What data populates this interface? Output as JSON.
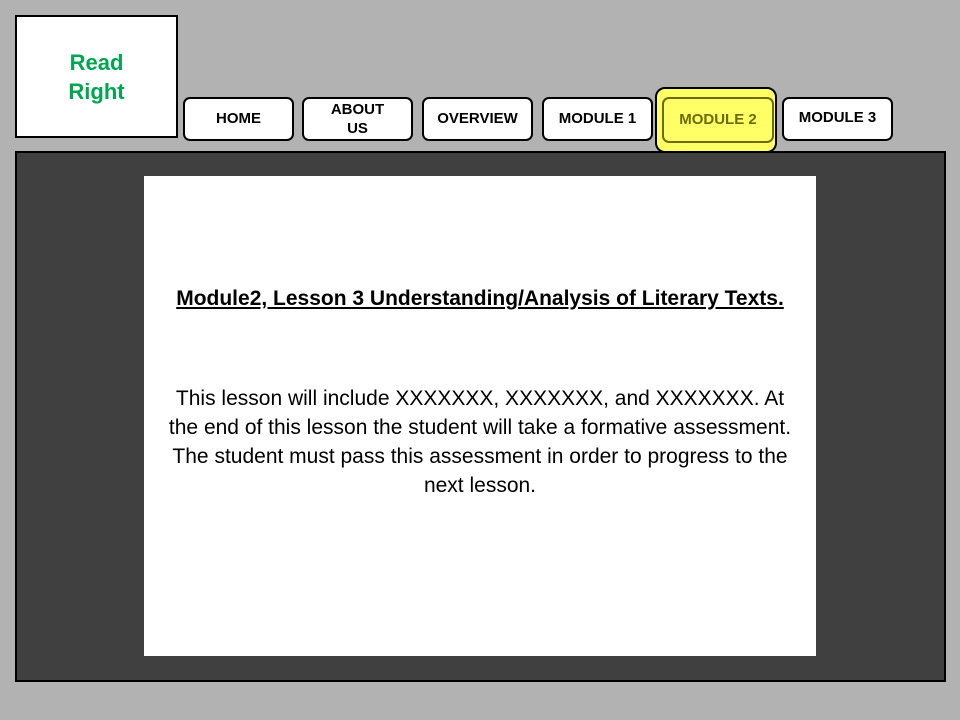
{
  "logo": {
    "line1": "Read",
    "line2": "Right"
  },
  "nav": {
    "home": "HOME",
    "about_line1": "ABOUT",
    "about_line2": "US",
    "overview": "OVERVIEW",
    "module1": "MODULE 1",
    "module2": "MODULE 2",
    "module3": "MODULE 3",
    "active": "MODULE 2"
  },
  "content": {
    "title": "Module2, Lesson 3 Understanding/Analysis of Literary Texts.",
    "body": "This lesson will include XXXXXXX,  XXXXXXX,  and XXXXXXX.  At the end of this lesson the student will take a formative assessment. The student must pass this assessment in order to progress to the next lesson."
  },
  "colors": {
    "page_background": "#b2b2b2",
    "panel_background": "#404040",
    "logo_text": "#00a650",
    "active_tab": "#ffff66",
    "active_tab_text": "#6b6b00"
  }
}
